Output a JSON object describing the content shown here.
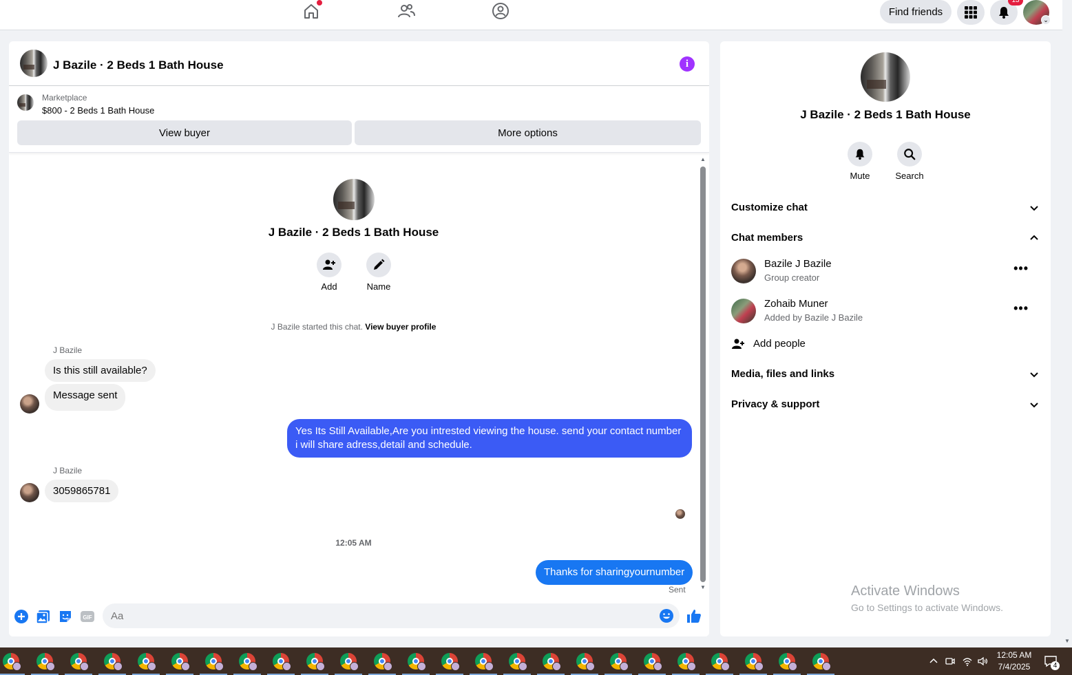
{
  "topnav": {
    "find_friends": "Find friends",
    "notification_count": "13",
    "colors": {
      "home_dot": "#e41e3f",
      "badge": "#e41e3f"
    }
  },
  "chat": {
    "title": "J Bazile · 2 Beds 1 Bath House",
    "marketplace": {
      "label": "Marketplace",
      "listing": "$800 - 2 Beds 1 Bath House",
      "view_buyer": "View buyer",
      "more_options": "More options"
    },
    "intro": {
      "title": "J Bazile · 2 Beds 1 Bath House",
      "add_label": "Add",
      "name_label": "Name",
      "started_text": "J Bazile started this chat.",
      "started_link": "View buyer profile"
    },
    "messages": [
      {
        "sender": "J Bazile",
        "text": "Is this still available?"
      },
      {
        "text": "Message sent"
      },
      {
        "text": "Yes Its Still Available,Are you intrested viewing the house. send your contact number i will share adress,detail and schedule."
      },
      {
        "sender": "J Bazile",
        "text": "3059865781"
      },
      {
        "text": "Thanks for sharingyournumber"
      }
    ],
    "timestamp": "12:05 AM",
    "sent_status": "Sent",
    "composer_placeholder": "Aa",
    "colors": {
      "outgoing_bubble": "#3b5bf5",
      "outgoing_bubble_last": "#1877f2",
      "accent": "#1877f2",
      "info_icon": "#a033ff"
    }
  },
  "info_panel": {
    "title": "J Bazile · 2 Beds 1 Bath House",
    "mute_label": "Mute",
    "search_label": "Search",
    "customize_chat": "Customize chat",
    "chat_members": "Chat members",
    "members": [
      {
        "name": "Bazile J Bazile",
        "role": "Group creator"
      },
      {
        "name": "Zohaib Muner",
        "role": "Added by Bazile J Bazile"
      }
    ],
    "add_people": "Add people",
    "media_files_links": "Media, files and links",
    "privacy_support": "Privacy & support"
  },
  "watermark": {
    "title": "Activate Windows",
    "subtitle": "Go to Settings to activate Windows."
  },
  "taskbar": {
    "time": "12:05 AM",
    "date": "7/4/2025",
    "notification_count": "4",
    "app_icon": "chrome-icon"
  }
}
